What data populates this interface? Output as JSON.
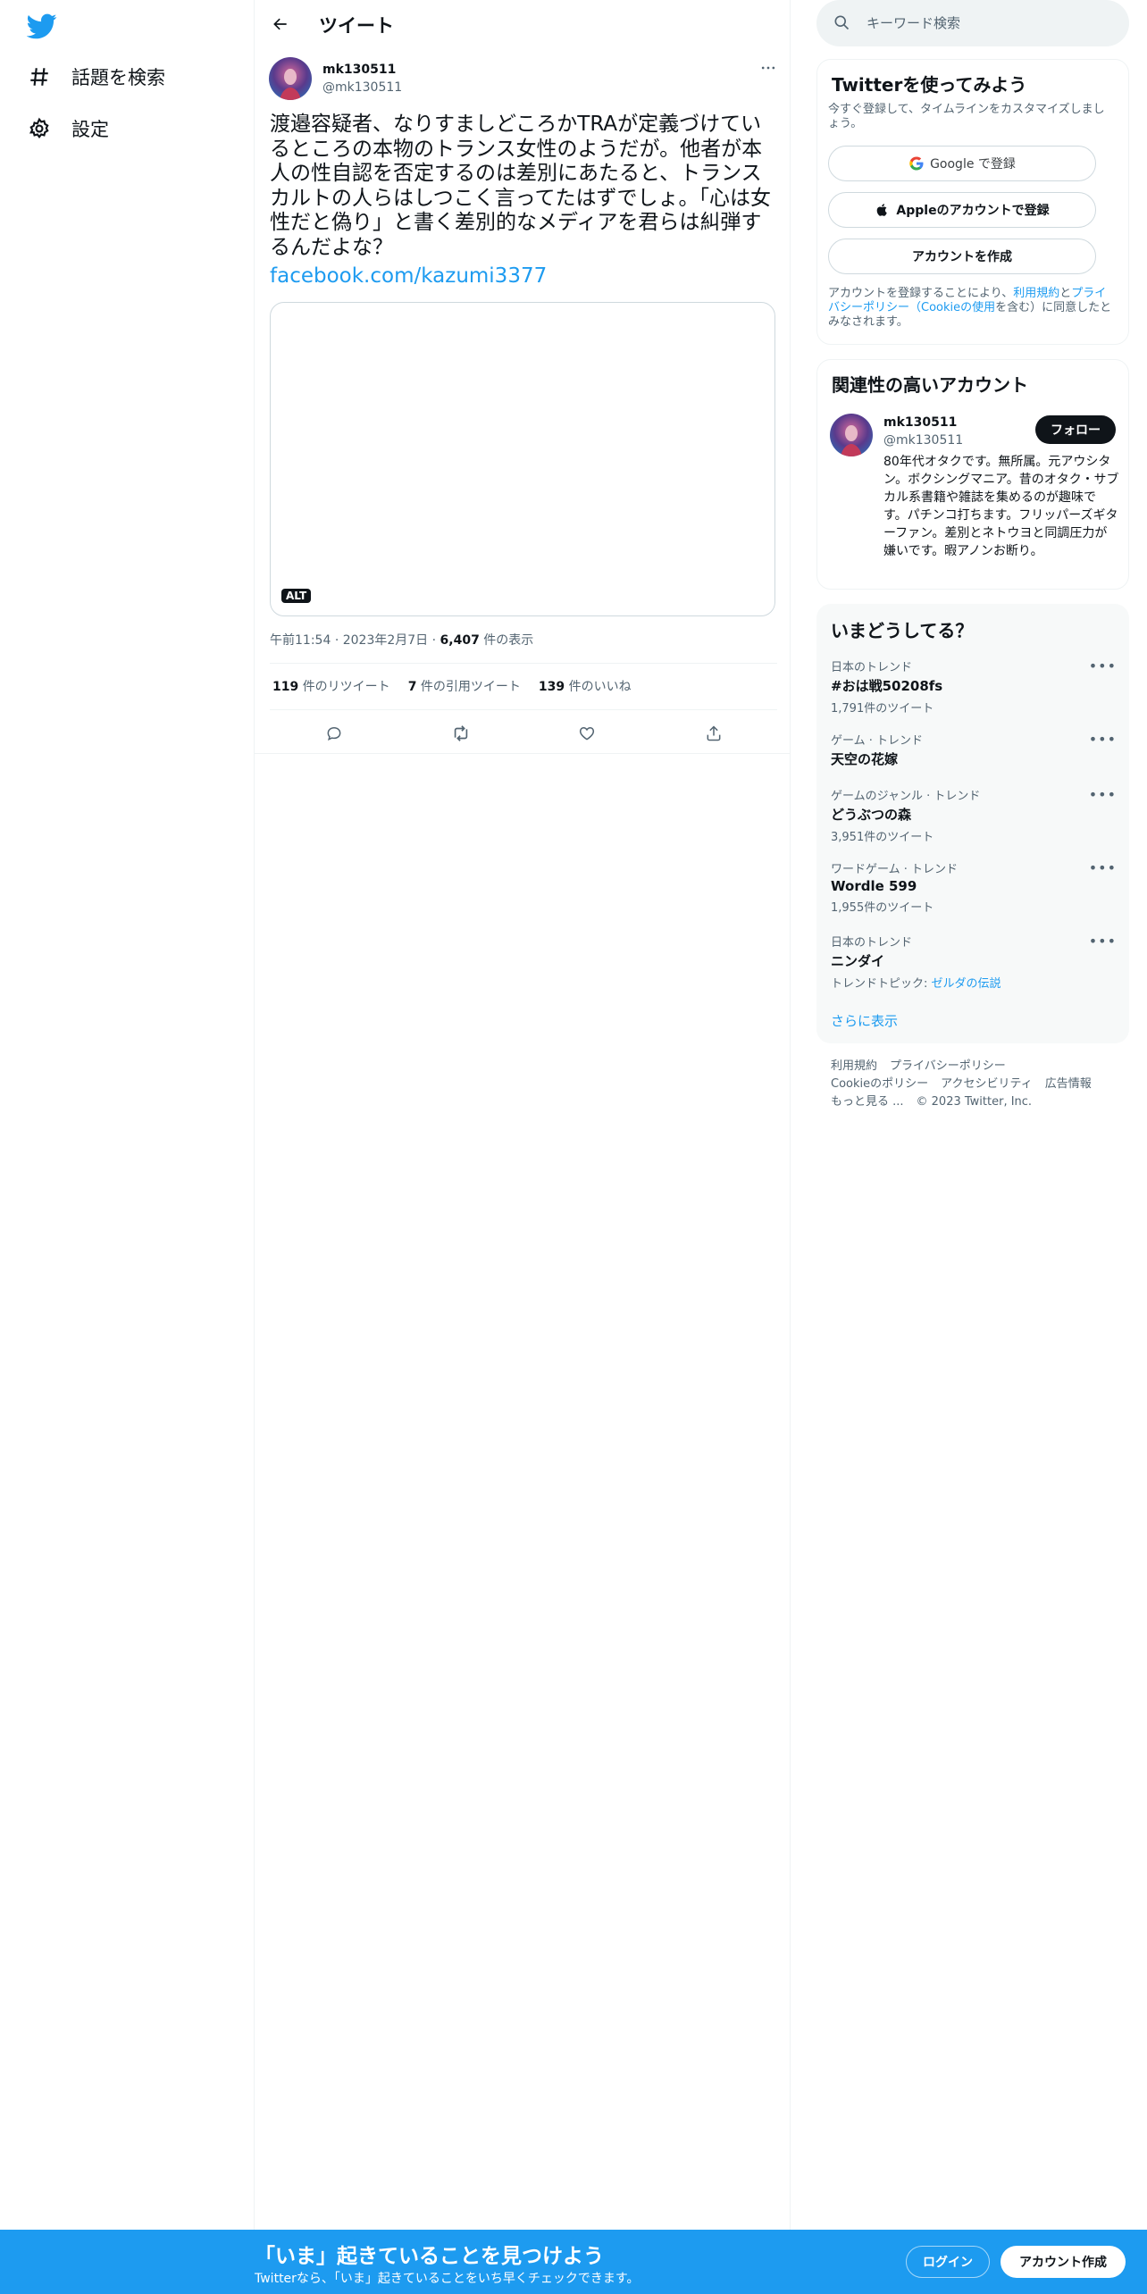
{
  "nav": {
    "explore_label": "話題を検索",
    "settings_label": "設定"
  },
  "header": {
    "title": "ツイート"
  },
  "tweet": {
    "author_name": "mk130511",
    "author_handle": "@mk130511",
    "text": "渡邉容疑者、なりすましどころかTRAが定義づけているところの本物のトランス女性のようだが。他者が本人の性自認を否定するのは差別にあたると、トランスカルトの人らはしつこく言ってたはずでしょ。「心は女性だと偽り」と書く差別的なメディアを君らは糾弾するんだよな？",
    "link": "facebook.com/kazumi3377",
    "alt_badge": "ALT",
    "time": "午前11:54",
    "date": "2023年2月7日",
    "views_count": "6,407",
    "views_label": "件の表示",
    "retweets_count": "119",
    "retweets_label": "件のリツイート",
    "quotes_count": "7",
    "quotes_label": "件の引用ツイート",
    "likes_count": "139",
    "likes_label": "件のいいね"
  },
  "search": {
    "placeholder": "キーワード検索"
  },
  "signup_card": {
    "title": "Twitterを使ってみよう",
    "subtitle": "今すぐ登録して、タイムラインをカスタマイズしましょう。",
    "google_label": "Google で登録",
    "apple_label": "Appleのアカウントで登録",
    "create_label": "アカウントを作成",
    "terms_prefix": "アカウントを登録することにより、",
    "terms_link": "利用規約",
    "terms_and": "と",
    "privacy_link": "プライバシーポリシー",
    "cookie_link": "（Cookieの使用",
    "terms_suffix": "を含む）に同意したとみなされます。"
  },
  "relevant": {
    "title": "関連性の高いアカウント",
    "name": "mk130511",
    "handle": "@mk130511",
    "follow_label": "フォロー",
    "bio": "80年代オタクです。無所属。元アウシタン。ボクシングマニア。昔のオタク・サブカル系書籍や雑誌を集めるのが趣味です。パチンコ打ちます。フリッパーズギターファン。差別とネトウヨと同調圧力が嫌いです。暇アノンお断り。"
  },
  "trends": {
    "title": "いまどうしてる？",
    "items": [
      {
        "category": "日本のトレンド",
        "name": "#おは戦50208fs",
        "count": "1,791件のツイート"
      },
      {
        "category": "ゲーム · トレンド",
        "name": "天空の花嫁",
        "count": ""
      },
      {
        "category": "ゲームのジャンル · トレンド",
        "name": "どうぶつの森",
        "count": "3,951件のツイート"
      },
      {
        "category": "ワードゲーム · トレンド",
        "name": "Wordle 599",
        "count": "1,955件のツイート"
      },
      {
        "category": "日本のトレンド",
        "name": "ニンダイ",
        "count": ""
      }
    ],
    "topic_prefix": "トレンドトピック: ",
    "topic_link": "ゼルダの伝説",
    "show_more": "さらに表示"
  },
  "footer": {
    "terms": "利用規約",
    "privacy": "プライバシーポリシー",
    "cookie": "Cookieのポリシー",
    "accessibility": "アクセシビリティ",
    "ads": "広告情報",
    "more": "もっと見る ...",
    "copyright": "© 2023 Twitter, Inc."
  },
  "bottom_bar": {
    "title": "「いま」起きていることを見つけよう",
    "subtitle": "Twitterなら、「いま」起きていることをいち早くチェックできます。",
    "login_label": "ログイン",
    "signup_label": "アカウント作成"
  },
  "colors": {
    "brand": "#1d9bf0",
    "text": "#0f1419",
    "secondary": "#536471"
  }
}
